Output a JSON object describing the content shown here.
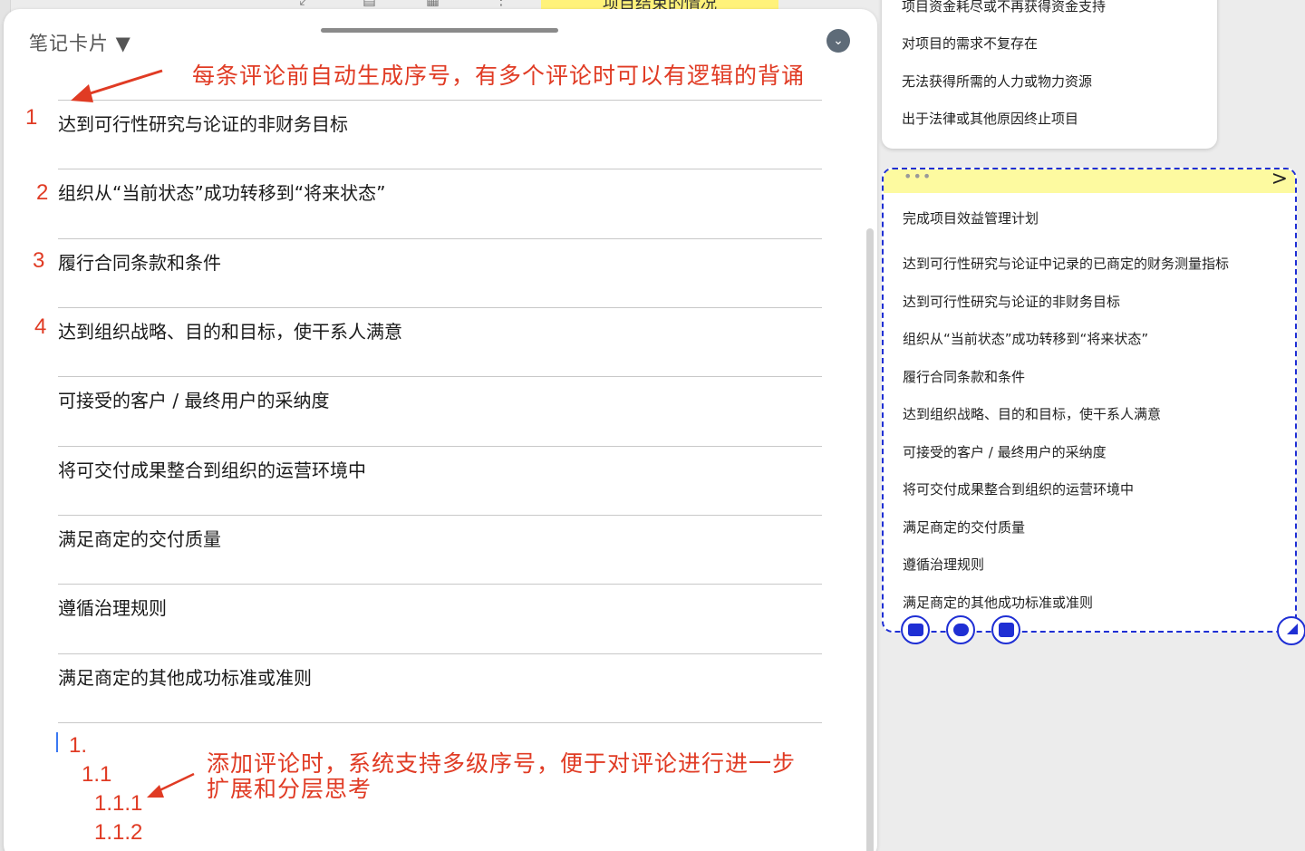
{
  "toolbar": {
    "sticky_title": "项目结束的情况"
  },
  "panel": {
    "title": "笔记卡片 ▼",
    "collapse_icon": "chevron-down-icon",
    "comments": [
      {
        "num": "1",
        "text": "达到可行性研究与论证的非财务目标"
      },
      {
        "num": "2",
        "text": "组织从“当前状态”成功转移到“将来状态”"
      },
      {
        "num": "3",
        "text": "履行合同条款和条件"
      },
      {
        "num": "4",
        "text": "达到组织战略、目的和目标，使干系人满意"
      },
      {
        "num": "",
        "text": "可接受的客户 / 最终用户的采纳度"
      },
      {
        "num": "",
        "text": "将可交付成果整合到组织的运营环境中"
      },
      {
        "num": "",
        "text": "满足商定的交付质量"
      },
      {
        "num": "",
        "text": "遵循治理规则"
      },
      {
        "num": "",
        "text": "满足商定的其他成功标准或准则"
      }
    ],
    "outline": [
      "1.",
      "1.1",
      "1.1.1",
      "1.1.2"
    ]
  },
  "annotations": {
    "top": "每条评论前自动生成序号，有多个评论时可以有逻辑的背诵",
    "bottom_line1": "添加评论时，系统支持多级序号，便于对评论进行进一步",
    "bottom_line2": "扩展和分层思考"
  },
  "right_top_list": [
    "项目资金耗尽或不再获得资金支持",
    "对项目的需求不复存在",
    "无法获得所需的人力或物力资源",
    "出于法律或其他原因终止项目"
  ],
  "right_card": {
    "items": [
      "完成项目效益管理计划",
      "达到可行性研究与论证中记录的已商定的财务测量指标",
      "达到可行性研究与论证的非财务目标",
      "组织从“当前状态”成功转移到“将来状态”",
      "履行合同条款和条件",
      "达到组织战略、目的和目标，使干系人满意",
      "可接受的客户 / 最终用户的采纳度",
      "将可交付成果整合到组织的运营环境中",
      "满足商定的交付质量",
      "遵循治理规则",
      "满足商定的其他成功标准或准则"
    ],
    "header_dots": "•••",
    "header_arrow": ">"
  },
  "colors": {
    "annotation": "#e03b24",
    "card_border": "#1f2fd4",
    "card_header": "#fdfaa0"
  }
}
